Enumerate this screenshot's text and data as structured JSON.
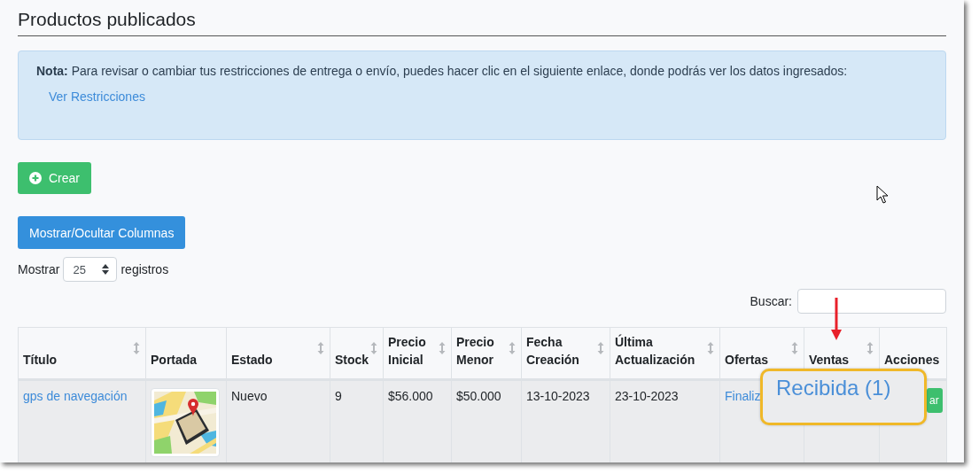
{
  "heading": "Productos publicados",
  "note": {
    "text": "**Nota:** Para revisar o cambiar tus restricciones de entrega o envío, puedes hacer clic en el siguiente enlace, donde podrás ver los datos ingresados:",
    "link": "Ver Restricciones"
  },
  "create_button": "Crear",
  "columns_button": "Mostrar/Ocultar Columnas",
  "length": {
    "before": "Mostrar",
    "value": "25",
    "after": "registros"
  },
  "search": {
    "label": "Buscar:"
  },
  "table": {
    "columns": [
      {
        "label": "Título",
        "sortable": true
      },
      {
        "label": "Portada",
        "sortable": false
      },
      {
        "label": "Estado",
        "sortable": true
      },
      {
        "label": "Stock",
        "sortable": true
      },
      {
        "label": "Precio Inicial",
        "sortable": true
      },
      {
        "label": "Precio Menor",
        "sortable": true
      },
      {
        "label": "Fecha Creación",
        "sortable": true
      },
      {
        "label": "Última Actualización",
        "sortable": true
      },
      {
        "label": "Ofertas",
        "sortable": true
      },
      {
        "label": "Ventas",
        "sortable": true
      },
      {
        "label": "Acciones",
        "sortable": false
      }
    ],
    "rows": [
      {
        "cells": [
          {
            "kind": "link",
            "text": "gps de navegación"
          },
          {
            "kind": "picture"
          },
          {
            "kind": "text",
            "text": "Nuevo"
          },
          {
            "kind": "text",
            "text": "9"
          },
          {
            "kind": "text",
            "text": "$56.000"
          },
          {
            "kind": "text",
            "text": "$50.000"
          },
          {
            "kind": "text",
            "text": "13-10-2023"
          },
          {
            "kind": "text",
            "text": "23-10-2023"
          },
          {
            "kind": "link",
            "text": "Finaliz"
          },
          {
            "kind": "blank"
          },
          {
            "kind": "button",
            "text": "ar"
          }
        ]
      }
    ]
  },
  "callout": {
    "text": "Recibida (1)"
  }
}
